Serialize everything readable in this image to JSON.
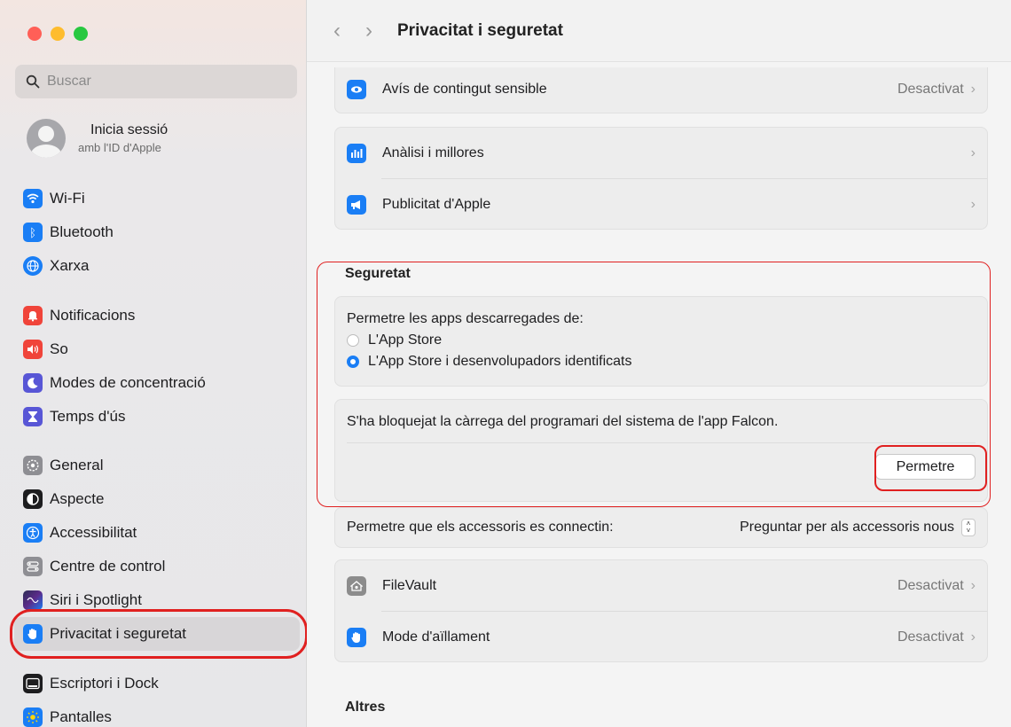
{
  "window": {
    "title": "Privacitat i seguretat"
  },
  "search": {
    "placeholder": "Buscar"
  },
  "profile": {
    "name": "Inicia sessió",
    "subtitle": "amb l'ID d'Apple"
  },
  "sidebar": {
    "items": [
      {
        "label": "Wi-Fi",
        "icon": "wifi-icon",
        "color": "#1a7ef5"
      },
      {
        "label": "Bluetooth",
        "icon": "bluetooth-icon",
        "color": "#1a7ef5"
      },
      {
        "label": "Xarxa",
        "icon": "globe-icon",
        "color": "#1a7ef5"
      },
      {
        "label": "Notificacions",
        "icon": "bell-icon",
        "color": "#f0443a"
      },
      {
        "label": "So",
        "icon": "speaker-icon",
        "color": "#f0443a"
      },
      {
        "label": "Modes de concentració",
        "icon": "moon-icon",
        "color": "#5856d6"
      },
      {
        "label": "Temps d'ús",
        "icon": "hourglass-icon",
        "color": "#5856d6"
      },
      {
        "label": "General",
        "icon": "gear-icon",
        "color": "#8e8e93"
      },
      {
        "label": "Aspecte",
        "icon": "appearance-icon",
        "color": "#1d1d1f"
      },
      {
        "label": "Accessibilitat",
        "icon": "accessibility-icon",
        "color": "#1a7ef5"
      },
      {
        "label": "Centre de control",
        "icon": "control-center-icon",
        "color": "#8e8e93"
      },
      {
        "label": "Siri i Spotlight",
        "icon": "siri-icon",
        "color": "#2c2c54"
      },
      {
        "label": "Privacitat i seguretat",
        "icon": "hand-icon",
        "color": "#1a7ef5"
      },
      {
        "label": "Escriptori i Dock",
        "icon": "dock-icon",
        "color": "#1d1d1f"
      },
      {
        "label": "Pantalles",
        "icon": "sun-icon",
        "color": "#1a7ef5"
      }
    ]
  },
  "main": {
    "sensitive": {
      "label": "Avís de contingut sensible",
      "value": "Desactivat"
    },
    "analytics": {
      "label": "Anàlisi i millores"
    },
    "ads": {
      "label": "Publicitat d'Apple"
    },
    "security": {
      "title": "Seguretat",
      "allow_label": "Permetre les apps descarregades de:",
      "options": [
        "L'App Store",
        "L'App Store i desenvolupadors identificats"
      ],
      "selected_option": "L'App Store i desenvolupadors identificats",
      "blocked_message": "S'ha bloquejat la càrrega del programari del sistema de l'app Falcon.",
      "allow_button": "Permetre"
    },
    "accessories": {
      "label": "Permetre que els accessoris es connectin:",
      "value": "Preguntar per als accessoris nous"
    },
    "filevault": {
      "label": "FileVault",
      "value": "Desactivat"
    },
    "lockdown": {
      "label": "Mode d'aïllament",
      "value": "Desactivat"
    },
    "others_title": "Altres"
  }
}
